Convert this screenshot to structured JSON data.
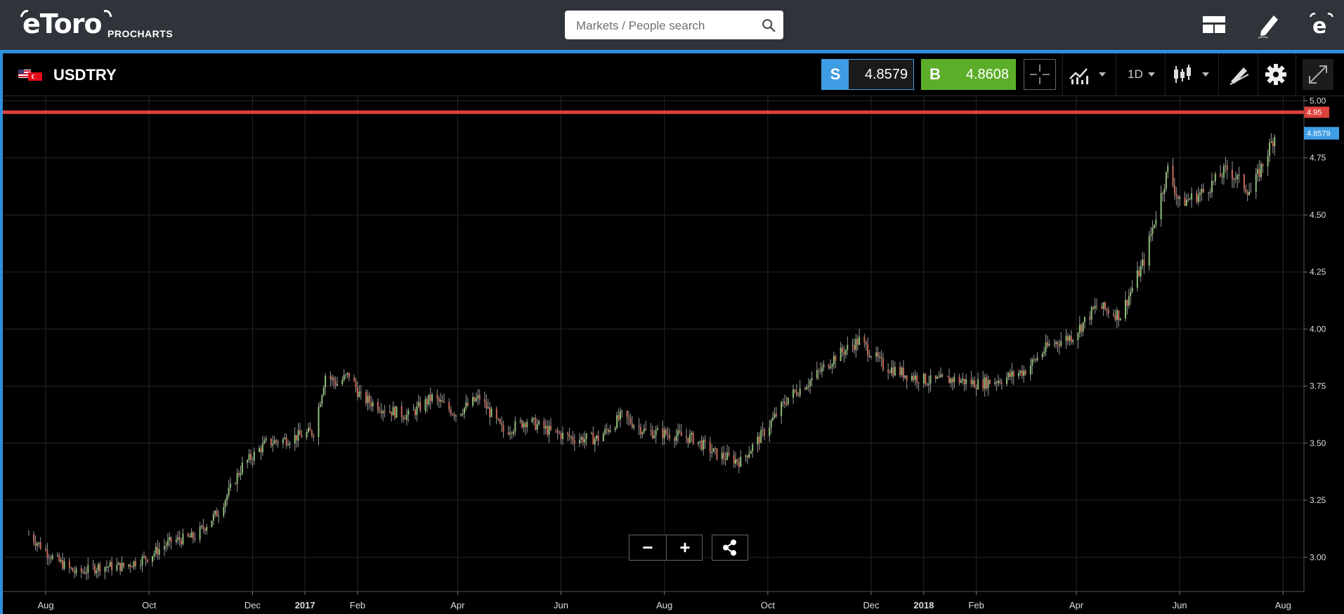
{
  "brand": {
    "logo_text": "eToro",
    "product": "PROCHARTS"
  },
  "search": {
    "placeholder": "Markets / People search"
  },
  "header_icons": [
    "layout-icon",
    "edit-icon",
    "etoro-e-icon"
  ],
  "instrument": {
    "symbol": "USDTRY",
    "flag_icon": "us-tr-flag-icon"
  },
  "trade": {
    "sell_label": "S",
    "sell_price": "4.8579",
    "buy_label": "B",
    "buy_price": "4.8608",
    "sell_color": "#3f9de3",
    "buy_color": "#5cae2a"
  },
  "toolbar": {
    "timeframe": "1D",
    "icons": [
      "crosshair-icon",
      "indicators-icon",
      "candlestick-icon",
      "drawing-tools-icon",
      "settings-icon",
      "fullscreen-icon"
    ]
  },
  "chart_controls": {
    "zoom_out": "−",
    "zoom_in": "+",
    "share_icon": "share-icon"
  },
  "chart_data": {
    "type": "candlestick",
    "y_ticks": [
      "5.00",
      "4.75",
      "4.50",
      "4.25",
      "4.00",
      "3.75",
      "3.50",
      "3.25",
      "3.00"
    ],
    "ylim": [
      2.85,
      5.02
    ],
    "x_ticks": [
      "Aug",
      "Oct",
      "Dec",
      "2017",
      "Feb",
      "Apr",
      "Jun",
      "Aug",
      "Oct",
      "Dec",
      "2018",
      "Feb",
      "Apr",
      "Jun",
      "Aug"
    ],
    "grid": true,
    "horizontal_line": {
      "value": 4.95,
      "label": "4.95",
      "color": "#e0403c"
    },
    "last_price_label": {
      "value": 4.8579,
      "label": "4.8579",
      "color": "#3f9de3"
    },
    "series": [
      {
        "date": "2016-07-22",
        "close": 3.1
      },
      {
        "date": "2016-08-05",
        "close": 3.0
      },
      {
        "date": "2016-08-19",
        "close": 2.93
      },
      {
        "date": "2016-09-02",
        "close": 2.96
      },
      {
        "date": "2016-09-16",
        "close": 2.96
      },
      {
        "date": "2016-09-30",
        "close": 3.0
      },
      {
        "date": "2016-10-14",
        "close": 3.07
      },
      {
        "date": "2016-10-28",
        "close": 3.09
      },
      {
        "date": "2016-11-11",
        "close": 3.2
      },
      {
        "date": "2016-11-25",
        "close": 3.4
      },
      {
        "date": "2016-12-09",
        "close": 3.5
      },
      {
        "date": "2016-12-23",
        "close": 3.52
      },
      {
        "date": "2017-01-06",
        "close": 3.55
      },
      {
        "date": "2017-01-13",
        "close": 3.8
      },
      {
        "date": "2017-01-20",
        "close": 3.76
      },
      {
        "date": "2017-01-27",
        "close": 3.8
      },
      {
        "date": "2017-02-03",
        "close": 3.7
      },
      {
        "date": "2017-02-17",
        "close": 3.65
      },
      {
        "date": "2017-03-03",
        "close": 3.62
      },
      {
        "date": "2017-03-17",
        "close": 3.7
      },
      {
        "date": "2017-03-31",
        "close": 3.63
      },
      {
        "date": "2017-04-14",
        "close": 3.7
      },
      {
        "date": "2017-04-28",
        "close": 3.55
      },
      {
        "date": "2017-05-12",
        "close": 3.6
      },
      {
        "date": "2017-05-26",
        "close": 3.55
      },
      {
        "date": "2017-06-09",
        "close": 3.52
      },
      {
        "date": "2017-06-23",
        "close": 3.52
      },
      {
        "date": "2017-07-07",
        "close": 3.62
      },
      {
        "date": "2017-07-21",
        "close": 3.55
      },
      {
        "date": "2017-08-04",
        "close": 3.54
      },
      {
        "date": "2017-08-18",
        "close": 3.52
      },
      {
        "date": "2017-09-01",
        "close": 3.45
      },
      {
        "date": "2017-09-15",
        "close": 3.42
      },
      {
        "date": "2017-09-29",
        "close": 3.55
      },
      {
        "date": "2017-10-13",
        "close": 3.7
      },
      {
        "date": "2017-10-27",
        "close": 3.78
      },
      {
        "date": "2017-11-10",
        "close": 3.88
      },
      {
        "date": "2017-11-24",
        "close": 3.95
      },
      {
        "date": "2017-12-08",
        "close": 3.84
      },
      {
        "date": "2017-12-22",
        "close": 3.8
      },
      {
        "date": "2018-01-05",
        "close": 3.77
      },
      {
        "date": "2018-01-19",
        "close": 3.78
      },
      {
        "date": "2018-02-02",
        "close": 3.76
      },
      {
        "date": "2018-02-16",
        "close": 3.78
      },
      {
        "date": "2018-03-02",
        "close": 3.82
      },
      {
        "date": "2018-03-16",
        "close": 3.93
      },
      {
        "date": "2018-03-30",
        "close": 3.97
      },
      {
        "date": "2018-04-13",
        "close": 4.1
      },
      {
        "date": "2018-04-27",
        "close": 4.06
      },
      {
        "date": "2018-05-11",
        "close": 4.3
      },
      {
        "date": "2018-05-25",
        "close": 4.7
      },
      {
        "date": "2018-06-01",
        "close": 4.55
      },
      {
        "date": "2018-06-15",
        "close": 4.6
      },
      {
        "date": "2018-06-29",
        "close": 4.7
      },
      {
        "date": "2018-07-13",
        "close": 4.6
      },
      {
        "date": "2018-07-27",
        "close": 4.85
      }
    ]
  }
}
